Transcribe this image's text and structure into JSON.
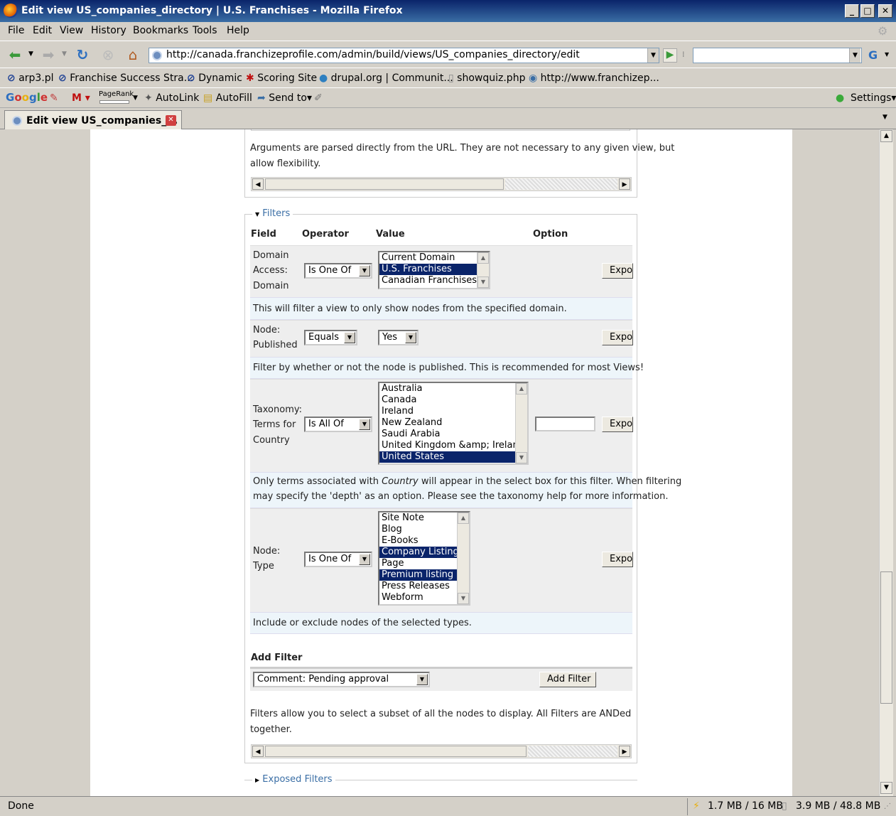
{
  "window": {
    "title": "Edit view US_companies_directory | U.S. Franchises - Mozilla Firefox"
  },
  "menu": [
    "File",
    "Edit",
    "View",
    "History",
    "Bookmarks",
    "Tools",
    "Help"
  ],
  "nav": {
    "url": "http://canada.franchizeprofile.com/admin/build/views/US_companies_directory/edit"
  },
  "bookmarks": [
    "arp3.pl",
    "Franchise Success Stra...",
    "Dynamic",
    "Scoring Site",
    "drupal.org | Communit...",
    "showquiz.php",
    "http://www.franchizep..."
  ],
  "googlebar": {
    "pagerank": "PageRank",
    "autolink": "AutoLink",
    "autofill": "AutoFill",
    "sendto": "Send to",
    "settings": "Settings"
  },
  "tab": {
    "label": "Edit view US_companies_..."
  },
  "arguments": {
    "description_1": "Arguments are parsed directly from the URL. They are not necessary to any given view, but",
    "description_2": "allow flexibility."
  },
  "filters": {
    "legend": "Filters",
    "headers": {
      "field": "Field",
      "operator": "Operator",
      "value": "Value",
      "option": "Option"
    },
    "rows": [
      {
        "field_lines": [
          "Domain",
          "Access:",
          "Domain"
        ],
        "operator": "Is One Of",
        "options": [
          "Current Domain",
          "U.S. Franchises",
          "Canadian Franchises"
        ],
        "selected": [
          1
        ],
        "button": "Expo",
        "description": "This will filter a view to only show nodes from the specified domain."
      },
      {
        "field_lines": [
          "Node:",
          "Published"
        ],
        "operator": "Equals",
        "value": "Yes",
        "button": "Expo",
        "description": "Filter by whether or not the node is published. This is recommended for most Views!"
      },
      {
        "field_lines": [
          "Taxonomy:",
          "Terms for",
          "Country"
        ],
        "operator": "Is All Of",
        "options": [
          "Australia",
          "Canada",
          "Ireland",
          "New Zealand",
          "Saudi Arabia",
          "United Kingdom &amp; Ireland",
          "United States"
        ],
        "selected": [
          6
        ],
        "button": "Expo",
        "description_pre": "Only terms associated with ",
        "description_em": "Country",
        "description_post": " will appear in the select box for this filter. When filtering",
        "description_2": "may specify the 'depth' as an option. Please see the taxonomy help for more information."
      },
      {
        "field_lines": [
          "Node:",
          "Type"
        ],
        "operator": "Is One Of",
        "options": [
          "Site Note",
          "Blog",
          "E-Books",
          "Company Listing",
          "Page",
          "Premium listing",
          "Press Releases",
          "Webform"
        ],
        "selected": [
          3,
          5
        ],
        "button": "Expo",
        "description": "Include or exclude nodes of the selected types."
      }
    ],
    "add_filter": {
      "heading": "Add Filter",
      "select_value": "Comment: Pending approval",
      "button": "Add Filter"
    },
    "footer_1": "Filters allow you to select a subset of all the nodes to display. All Filters are ANDed",
    "footer_2": "together."
  },
  "exposed_filters": {
    "legend": "Exposed Filters"
  },
  "status": {
    "text": "Done",
    "mem1": "1.7 MB / 16 MB",
    "mem2": "3.9 MB / 48.8 MB"
  }
}
